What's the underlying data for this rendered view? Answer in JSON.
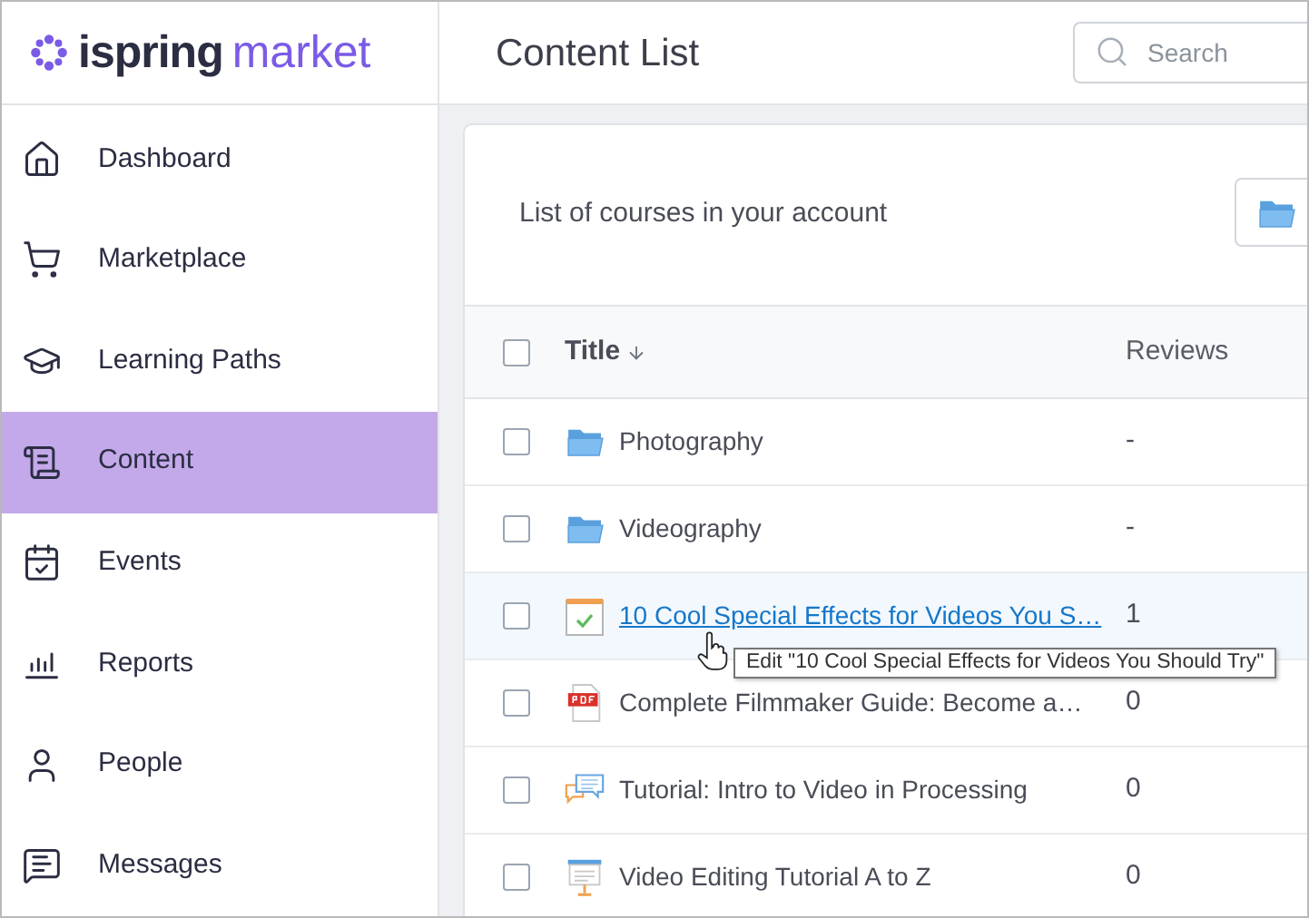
{
  "logo": {
    "brand": "ispring",
    "product": "market"
  },
  "header": {
    "title": "Content List",
    "search": {
      "placeholder": "Search"
    }
  },
  "sidebar": {
    "items": [
      {
        "label": "Dashboard",
        "selected": false
      },
      {
        "label": "Marketplace",
        "selected": false
      },
      {
        "label": "Learning Paths",
        "selected": false
      },
      {
        "label": "Content",
        "selected": true
      },
      {
        "label": "Events",
        "selected": false
      },
      {
        "label": "Reports",
        "selected": false
      },
      {
        "label": "People",
        "selected": false
      },
      {
        "label": "Messages",
        "selected": false
      }
    ]
  },
  "card": {
    "description": "List of courses in your account"
  },
  "table": {
    "select_all": {
      "checked": false
    },
    "columns": [
      {
        "label": "Title",
        "sorted": true
      },
      {
        "label": "Reviews",
        "sorted": false
      }
    ],
    "rows": [
      {
        "kind": "folder",
        "title": "Photography",
        "reviews": "-",
        "checked": false,
        "hovered": false
      },
      {
        "kind": "folder",
        "title": "Videography",
        "reviews": "-",
        "checked": false,
        "hovered": false
      },
      {
        "kind": "quiz",
        "title": "10 Cool Special Effects for Videos You S…",
        "reviews": "1",
        "checked": false,
        "hovered": true
      },
      {
        "kind": "pdf",
        "title": "Complete Filmmaker Guide: Become a…",
        "reviews": "0",
        "checked": false,
        "hovered": false
      },
      {
        "kind": "dialog",
        "title": "Tutorial: Intro to Video in Processing",
        "reviews": "0",
        "checked": false,
        "hovered": false
      },
      {
        "kind": "presentation",
        "title": "Video Editing Tutorial A to Z",
        "reviews": "0",
        "checked": false,
        "hovered": false
      }
    ]
  },
  "tooltip": {
    "text": "Edit \"10 Cool Special Effects for Videos You Should Try\""
  }
}
